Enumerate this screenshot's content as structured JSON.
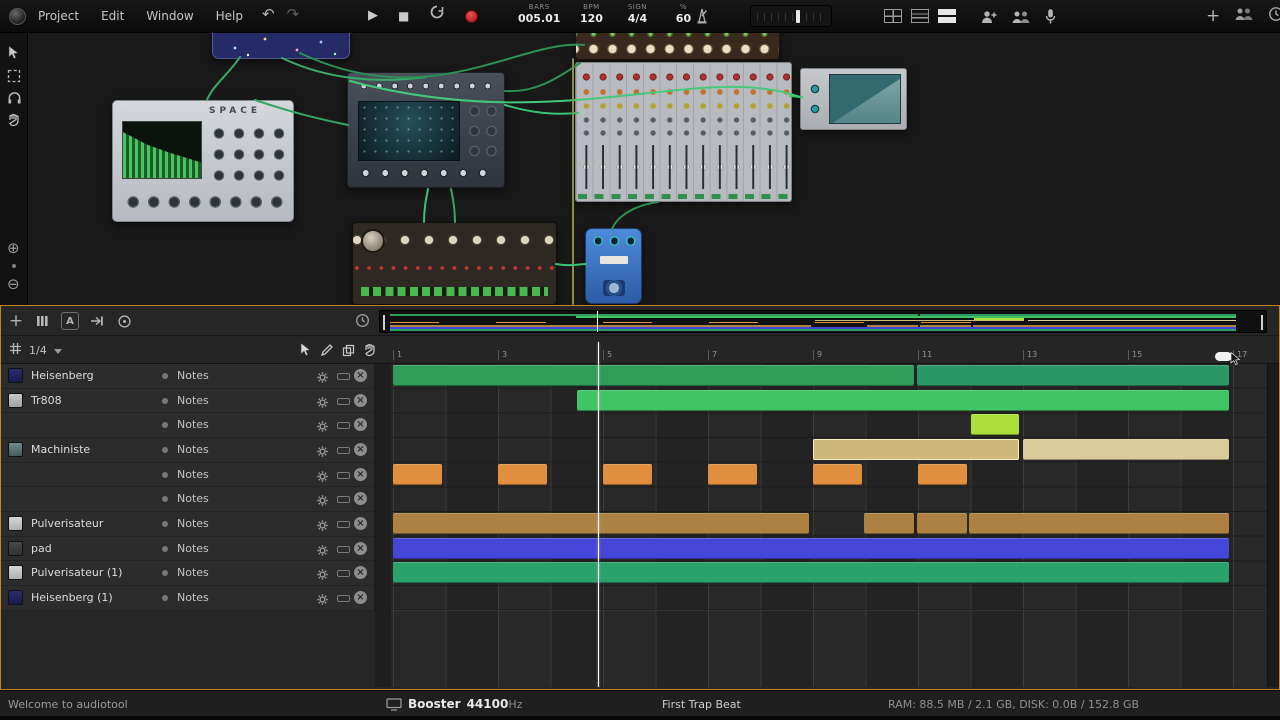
{
  "app": {
    "name": "audiotool"
  },
  "menubar": {
    "items": [
      "Project",
      "Edit",
      "Window",
      "Help"
    ]
  },
  "transport": {
    "displays": [
      {
        "label": "BARS",
        "value": "005.01"
      },
      {
        "label": "BPM",
        "value": "120"
      },
      {
        "label": "SIGN",
        "value": "4/4"
      },
      {
        "label": "%",
        "value": "60"
      }
    ]
  },
  "panel": {
    "grid_division": "1/4",
    "auto_button_label": "A",
    "ruler_bar_labels": [
      "1",
      "3",
      "5",
      "7",
      "9",
      "11",
      "13",
      "15",
      "17"
    ]
  },
  "devices": {
    "space_label": "SPACE"
  },
  "tracks": [
    {
      "name": "Heisenberg",
      "label": "Notes",
      "icon": "heisenberg"
    },
    {
      "name": "Tr808",
      "label": "Notes",
      "icon": "tr808"
    },
    {
      "name": "",
      "label": "Notes",
      "icon": null
    },
    {
      "name": "Machiniste",
      "label": "Notes",
      "icon": "machiniste"
    },
    {
      "name": "",
      "label": "Notes",
      "icon": null
    },
    {
      "name": "",
      "label": "Notes",
      "icon": null
    },
    {
      "name": "Pulverisateur",
      "label": "Notes",
      "icon": "pulverisateur"
    },
    {
      "name": "pad",
      "label": "Notes",
      "icon": "pad"
    },
    {
      "name": "Pulverisateur (1)",
      "label": "Notes",
      "icon": "pulverisateur"
    },
    {
      "name": "Heisenberg (1)",
      "label": "Notes",
      "icon": "heisenberg"
    }
  ],
  "clips": [
    {
      "track": 0,
      "start": 1,
      "end": 10.93,
      "color": "#2f9c59"
    },
    {
      "track": 0,
      "start": 10.98,
      "end": 16.93,
      "color": "#2c9868"
    },
    {
      "track": 1,
      "start": 4.5,
      "end": 16.93,
      "color": "#41c463"
    },
    {
      "track": 2,
      "start": 12,
      "end": 12.93,
      "color": "#abe03a"
    },
    {
      "track": 3,
      "start": 9,
      "end": 12.93,
      "color": "#cdb87c",
      "speckle": true,
      "selected": true
    },
    {
      "track": 3,
      "start": 13,
      "end": 16.93,
      "color": "#d9cc9b",
      "speckle": true
    },
    {
      "track": 4,
      "start": 1,
      "end": 1.93,
      "color": "#e08f3e"
    },
    {
      "track": 4,
      "start": 3,
      "end": 3.93,
      "color": "#e08f3e"
    },
    {
      "track": 4,
      "start": 5,
      "end": 5.93,
      "color": "#e08f3e"
    },
    {
      "track": 4,
      "start": 7,
      "end": 7.93,
      "color": "#e08f3e"
    },
    {
      "track": 4,
      "start": 9,
      "end": 9.93,
      "color": "#e08f3e"
    },
    {
      "track": 4,
      "start": 11,
      "end": 11.93,
      "color": "#e08f3e"
    },
    {
      "track": 6,
      "start": 1,
      "end": 8.93,
      "color": "#ad8142",
      "speckle": true
    },
    {
      "track": 6,
      "start": 9.98,
      "end": 10.93,
      "color": "#ad8142",
      "speckle": true
    },
    {
      "track": 6,
      "start": 10.98,
      "end": 11.93,
      "color": "#ad8142",
      "speckle": true
    },
    {
      "track": 6,
      "start": 11.98,
      "end": 16.93,
      "color": "#ad8142",
      "speckle": true
    },
    {
      "track": 7,
      "start": 1,
      "end": 16.93,
      "color": "#4646d8",
      "shade": true
    },
    {
      "track": 8,
      "start": 1,
      "end": 16.93,
      "color": "#2aa26c",
      "shade": true
    }
  ],
  "playhead_bar": 4.9,
  "statusbar": {
    "welcome": "Welcome to audiotool",
    "device_name": "Booster",
    "sample_rate": "44100",
    "sample_rate_unit": "Hz",
    "project_title": "First Trap Beat",
    "resources": "RAM: 88.5 MB / 2.1 GB, DISK: 0.0B / 152.8 GB"
  },
  "colors": {
    "panel_border": "#c08427",
    "playhead": "#ffffff"
  }
}
